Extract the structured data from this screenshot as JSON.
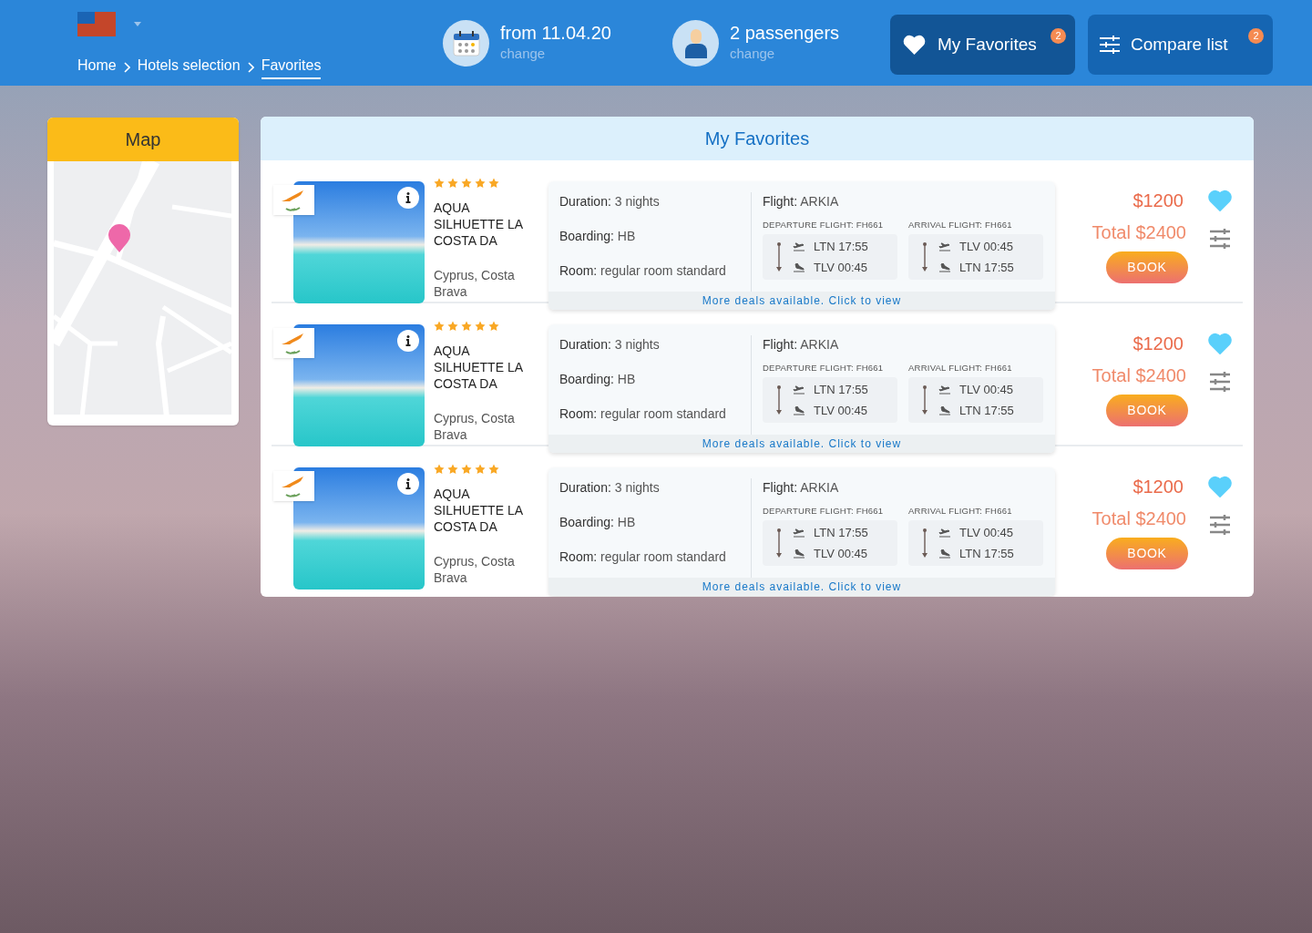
{
  "header": {
    "breadcrumbs": [
      {
        "label": "Home",
        "selected": false
      },
      {
        "label": "Hotels selection",
        "selected": false
      },
      {
        "label": "Favorites",
        "selected": true
      }
    ],
    "date": {
      "value": "from 11.04.20",
      "action": "change"
    },
    "passengers": {
      "value": "2 passengers",
      "action": "change"
    },
    "buttons": [
      {
        "kind": "favorites",
        "label": "My Favorites",
        "count": "2"
      },
      {
        "kind": "compare",
        "label": "Compare list",
        "count": "2"
      }
    ]
  },
  "map": {
    "title": "Map"
  },
  "favorites": {
    "title": "My Favorites",
    "hotels": [
      {
        "stars": 5,
        "name": "AQUA SILHUETTE LA COSTA DA",
        "location": "Cyprus, Costa Brava",
        "duration_label": "Duration:",
        "duration": "3 nights",
        "boarding_label": "Boarding:",
        "boarding": "HB",
        "room_label": "Room:",
        "room": "regular room standard",
        "flight_label": "Flight:",
        "flight": "ARKIA",
        "departure_title": "DEPARTURE FLIGHT: FH661",
        "departure": [
          "LTN 17:55",
          "TLV 00:45"
        ],
        "arrival_title": "ARRIVAL FLIGHT: FH661",
        "arrival": [
          "TLV 00:45",
          "LTN 17:55"
        ],
        "more": "More deals available. Click to view",
        "price": "$1200",
        "total": "Total $2400",
        "book": "BOOK",
        "favorite": true
      },
      {
        "stars": 5,
        "name": "AQUA SILHUETTE LA COSTA DA",
        "location": "Cyprus, Costa Brava",
        "duration_label": "Duration:",
        "duration": "3 nights",
        "boarding_label": "Boarding:",
        "boarding": "HB",
        "room_label": "Room:",
        "room": "regular room standard",
        "flight_label": "Flight:",
        "flight": "ARKIA",
        "departure_title": "DEPARTURE FLIGHT: FH661",
        "departure": [
          "LTN 17:55",
          "TLV 00:45"
        ],
        "arrival_title": "ARRIVAL FLIGHT: FH661",
        "arrival": [
          "TLV 00:45",
          "LTN 17:55"
        ],
        "more": "More deals available. Click to view",
        "price": "$1200",
        "total": "Total $2400",
        "book": "BOOK",
        "favorite": true
      },
      {
        "stars": 5,
        "name": "AQUA SILHUETTE LA COSTA DA",
        "location": "Cyprus, Costa Brava",
        "duration_label": "Duration:",
        "duration": "3 nights",
        "boarding_label": "Boarding:",
        "boarding": "HB",
        "room_label": "Room:",
        "room": "regular room standard",
        "flight_label": "Flight:",
        "flight": "ARKIA",
        "departure_title": "DEPARTURE FLIGHT: FH661",
        "departure": [
          "LTN 17:55",
          "TLV 00:45"
        ],
        "arrival_title": "ARRIVAL FLIGHT: FH661",
        "arrival": [
          "TLV 00:45",
          "LTN 17:55"
        ],
        "more": "More deals available. Click to view",
        "price": "$1200",
        "total": "Total $2400",
        "book": "BOOK",
        "favorite": true
      }
    ]
  }
}
